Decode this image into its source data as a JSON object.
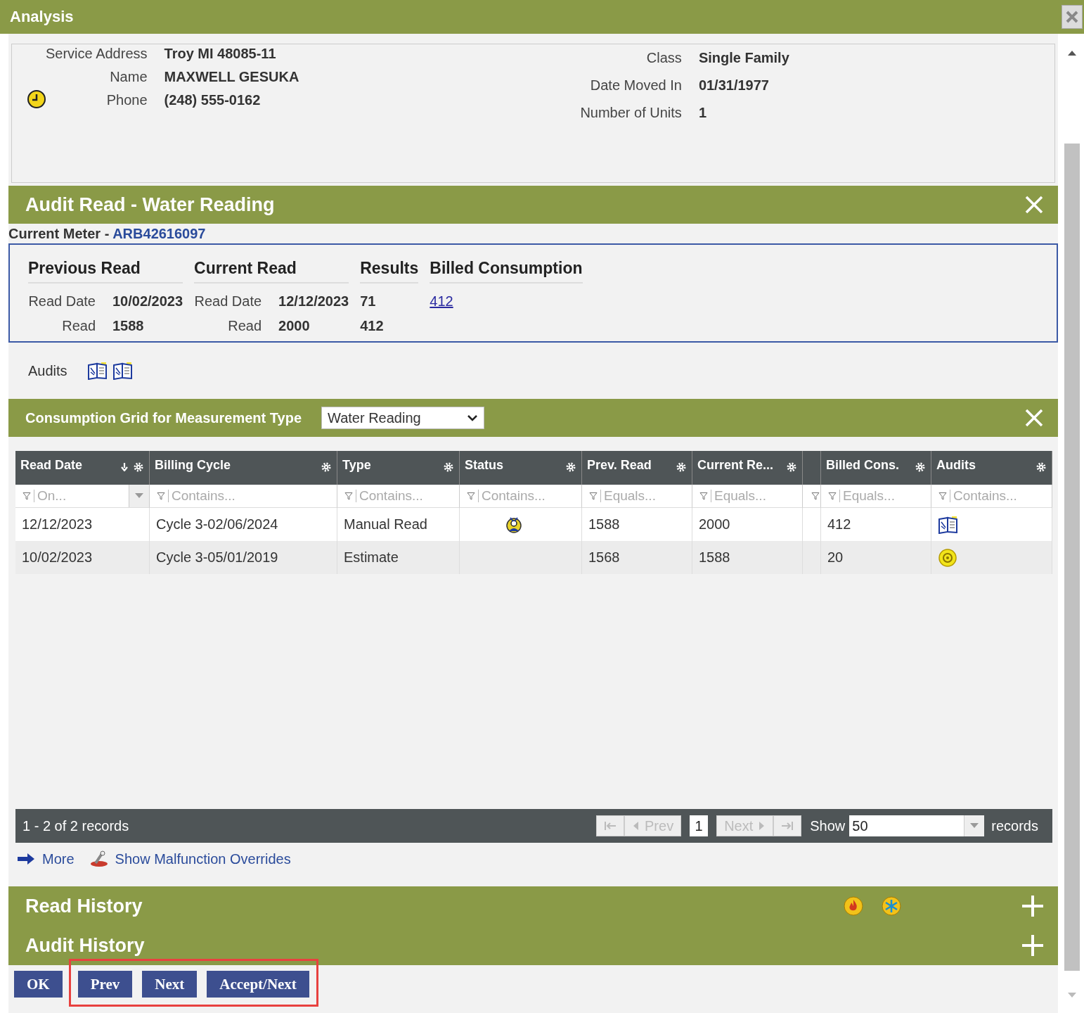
{
  "window": {
    "title": "Analysis"
  },
  "account": {
    "left": [
      {
        "label": "Service Address",
        "value": "Troy MI 48085-11"
      },
      {
        "label": "Name",
        "value": "MAXWELL GESUKA"
      },
      {
        "label": "Phone",
        "value": "(248) 555-0162"
      }
    ],
    "right": [
      {
        "label": "Class",
        "value": "Single Family"
      },
      {
        "label": "Date Moved In",
        "value": "01/31/1977"
      },
      {
        "label": "Number of Units",
        "value": "1"
      }
    ]
  },
  "audit_read": {
    "title": "Audit Read - Water Reading",
    "meter_label": "Current Meter - ",
    "meter_id": "ARB42616097",
    "groups": [
      {
        "heading": "Previous Read",
        "rows": [
          {
            "label": "Read Date",
            "value": "10/02/2023"
          },
          {
            "label": "Read",
            "value": "1588"
          }
        ]
      },
      {
        "heading": "Current Read",
        "rows": [
          {
            "label": "Read Date",
            "value": "12/12/2023"
          },
          {
            "label": "Read",
            "value": "2000"
          }
        ]
      },
      {
        "heading": "Results",
        "rows": [
          {
            "label": "",
            "value": "71"
          },
          {
            "label": "",
            "value": "412"
          }
        ]
      }
    ],
    "billed": {
      "heading": "Billed Consumption",
      "value": "412"
    },
    "audits_label": "Audits"
  },
  "grid": {
    "title": "Consumption Grid for Measurement Type",
    "measurement_type": "Water Reading",
    "columns": [
      {
        "label": "Read Date",
        "filter": "On...",
        "sorted": true,
        "kind": "dropdown"
      },
      {
        "label": "Billing Cycle",
        "filter": "Contains...",
        "sorted": false,
        "kind": "text"
      },
      {
        "label": "Type",
        "filter": "Contains...",
        "sorted": false,
        "kind": "text"
      },
      {
        "label": "Status",
        "filter": "Contains...",
        "sorted": false,
        "kind": "text"
      },
      {
        "label": "Prev. Read",
        "filter": "Equals...",
        "sorted": false,
        "kind": "text"
      },
      {
        "label": "Current Re...",
        "filter": "Equals...",
        "sorted": false,
        "kind": "text"
      },
      {
        "kind": "narrow"
      },
      {
        "label": "Billed Cons.",
        "filter": "Equals...",
        "sorted": false,
        "kind": "text"
      },
      {
        "label": "Audits",
        "filter": "Contains...",
        "sorted": false,
        "kind": "text"
      }
    ],
    "rows": [
      {
        "read_date": "12/12/2023",
        "billing_cycle": "Cycle 3-02/06/2024",
        "type": "Manual Read",
        "status_flag": true,
        "prev_read": "1588",
        "current_read": "2000",
        "billed": "412",
        "audited": true
      },
      {
        "read_date": "10/02/2023",
        "billing_cycle": "Cycle 3-05/01/2019",
        "type": "Estimate",
        "status_flag": false,
        "prev_read": "1568",
        "current_read": "1588",
        "billed": "20",
        "audited": false
      }
    ],
    "pager": {
      "summary": "1 - 2 of 2 records",
      "prev": "Prev",
      "page": "1",
      "next": "Next",
      "show": "Show",
      "page_size": "50",
      "records": "records"
    }
  },
  "links": [
    {
      "label": "More",
      "kind": "arrow"
    },
    {
      "label": "Show Malfunction Overrides",
      "kind": "tool"
    }
  ],
  "sections": [
    {
      "title": "Read History",
      "icons": true
    },
    {
      "title": "Audit History",
      "icons": false
    }
  ],
  "buttons": [
    {
      "label": "OK",
      "highlighted": false
    },
    {
      "label": "Prev",
      "highlighted": true
    },
    {
      "label": "Next",
      "highlighted": true
    },
    {
      "label": "Accept/Next",
      "highlighted": true
    }
  ]
}
